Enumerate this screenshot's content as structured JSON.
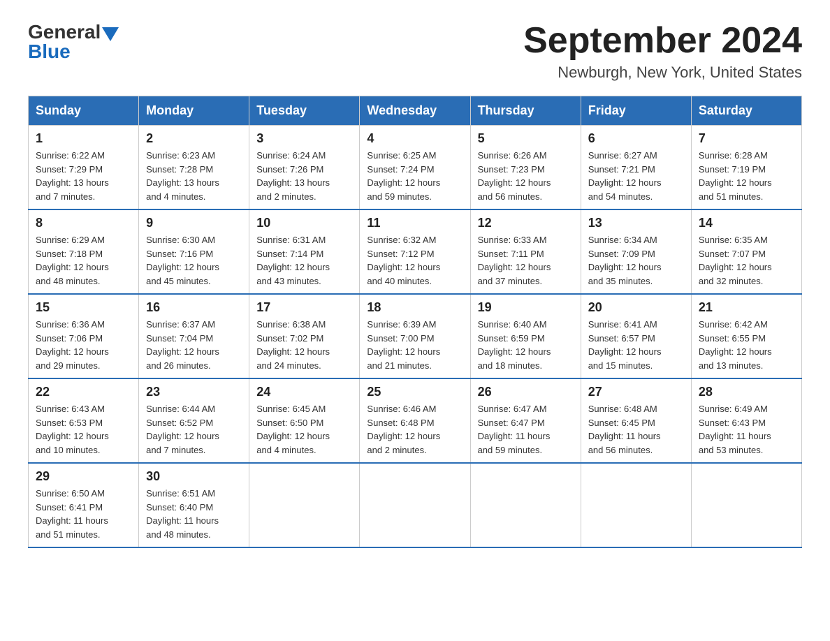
{
  "header": {
    "logo_general": "General",
    "logo_blue": "Blue",
    "title": "September 2024",
    "location": "Newburgh, New York, United States"
  },
  "weekdays": [
    "Sunday",
    "Monday",
    "Tuesday",
    "Wednesday",
    "Thursday",
    "Friday",
    "Saturday"
  ],
  "weeks": [
    [
      {
        "day": "1",
        "sunrise": "6:22 AM",
        "sunset": "7:29 PM",
        "daylight": "13 hours and 7 minutes."
      },
      {
        "day": "2",
        "sunrise": "6:23 AM",
        "sunset": "7:28 PM",
        "daylight": "13 hours and 4 minutes."
      },
      {
        "day": "3",
        "sunrise": "6:24 AM",
        "sunset": "7:26 PM",
        "daylight": "13 hours and 2 minutes."
      },
      {
        "day": "4",
        "sunrise": "6:25 AM",
        "sunset": "7:24 PM",
        "daylight": "12 hours and 59 minutes."
      },
      {
        "day": "5",
        "sunrise": "6:26 AM",
        "sunset": "7:23 PM",
        "daylight": "12 hours and 56 minutes."
      },
      {
        "day": "6",
        "sunrise": "6:27 AM",
        "sunset": "7:21 PM",
        "daylight": "12 hours and 54 minutes."
      },
      {
        "day": "7",
        "sunrise": "6:28 AM",
        "sunset": "7:19 PM",
        "daylight": "12 hours and 51 minutes."
      }
    ],
    [
      {
        "day": "8",
        "sunrise": "6:29 AM",
        "sunset": "7:18 PM",
        "daylight": "12 hours and 48 minutes."
      },
      {
        "day": "9",
        "sunrise": "6:30 AM",
        "sunset": "7:16 PM",
        "daylight": "12 hours and 45 minutes."
      },
      {
        "day": "10",
        "sunrise": "6:31 AM",
        "sunset": "7:14 PM",
        "daylight": "12 hours and 43 minutes."
      },
      {
        "day": "11",
        "sunrise": "6:32 AM",
        "sunset": "7:12 PM",
        "daylight": "12 hours and 40 minutes."
      },
      {
        "day": "12",
        "sunrise": "6:33 AM",
        "sunset": "7:11 PM",
        "daylight": "12 hours and 37 minutes."
      },
      {
        "day": "13",
        "sunrise": "6:34 AM",
        "sunset": "7:09 PM",
        "daylight": "12 hours and 35 minutes."
      },
      {
        "day": "14",
        "sunrise": "6:35 AM",
        "sunset": "7:07 PM",
        "daylight": "12 hours and 32 minutes."
      }
    ],
    [
      {
        "day": "15",
        "sunrise": "6:36 AM",
        "sunset": "7:06 PM",
        "daylight": "12 hours and 29 minutes."
      },
      {
        "day": "16",
        "sunrise": "6:37 AM",
        "sunset": "7:04 PM",
        "daylight": "12 hours and 26 minutes."
      },
      {
        "day": "17",
        "sunrise": "6:38 AM",
        "sunset": "7:02 PM",
        "daylight": "12 hours and 24 minutes."
      },
      {
        "day": "18",
        "sunrise": "6:39 AM",
        "sunset": "7:00 PM",
        "daylight": "12 hours and 21 minutes."
      },
      {
        "day": "19",
        "sunrise": "6:40 AM",
        "sunset": "6:59 PM",
        "daylight": "12 hours and 18 minutes."
      },
      {
        "day": "20",
        "sunrise": "6:41 AM",
        "sunset": "6:57 PM",
        "daylight": "12 hours and 15 minutes."
      },
      {
        "day": "21",
        "sunrise": "6:42 AM",
        "sunset": "6:55 PM",
        "daylight": "12 hours and 13 minutes."
      }
    ],
    [
      {
        "day": "22",
        "sunrise": "6:43 AM",
        "sunset": "6:53 PM",
        "daylight": "12 hours and 10 minutes."
      },
      {
        "day": "23",
        "sunrise": "6:44 AM",
        "sunset": "6:52 PM",
        "daylight": "12 hours and 7 minutes."
      },
      {
        "day": "24",
        "sunrise": "6:45 AM",
        "sunset": "6:50 PM",
        "daylight": "12 hours and 4 minutes."
      },
      {
        "day": "25",
        "sunrise": "6:46 AM",
        "sunset": "6:48 PM",
        "daylight": "12 hours and 2 minutes."
      },
      {
        "day": "26",
        "sunrise": "6:47 AM",
        "sunset": "6:47 PM",
        "daylight": "11 hours and 59 minutes."
      },
      {
        "day": "27",
        "sunrise": "6:48 AM",
        "sunset": "6:45 PM",
        "daylight": "11 hours and 56 minutes."
      },
      {
        "day": "28",
        "sunrise": "6:49 AM",
        "sunset": "6:43 PM",
        "daylight": "11 hours and 53 minutes."
      }
    ],
    [
      {
        "day": "29",
        "sunrise": "6:50 AM",
        "sunset": "6:41 PM",
        "daylight": "11 hours and 51 minutes."
      },
      {
        "day": "30",
        "sunrise": "6:51 AM",
        "sunset": "6:40 PM",
        "daylight": "11 hours and 48 minutes."
      },
      {
        "day": "",
        "sunrise": "",
        "sunset": "",
        "daylight": ""
      },
      {
        "day": "",
        "sunrise": "",
        "sunset": "",
        "daylight": ""
      },
      {
        "day": "",
        "sunrise": "",
        "sunset": "",
        "daylight": ""
      },
      {
        "day": "",
        "sunrise": "",
        "sunset": "",
        "daylight": ""
      },
      {
        "day": "",
        "sunrise": "",
        "sunset": "",
        "daylight": ""
      }
    ]
  ],
  "labels": {
    "sunrise_prefix": "Sunrise: ",
    "sunset_prefix": "Sunset: ",
    "daylight_prefix": "Daylight: "
  }
}
